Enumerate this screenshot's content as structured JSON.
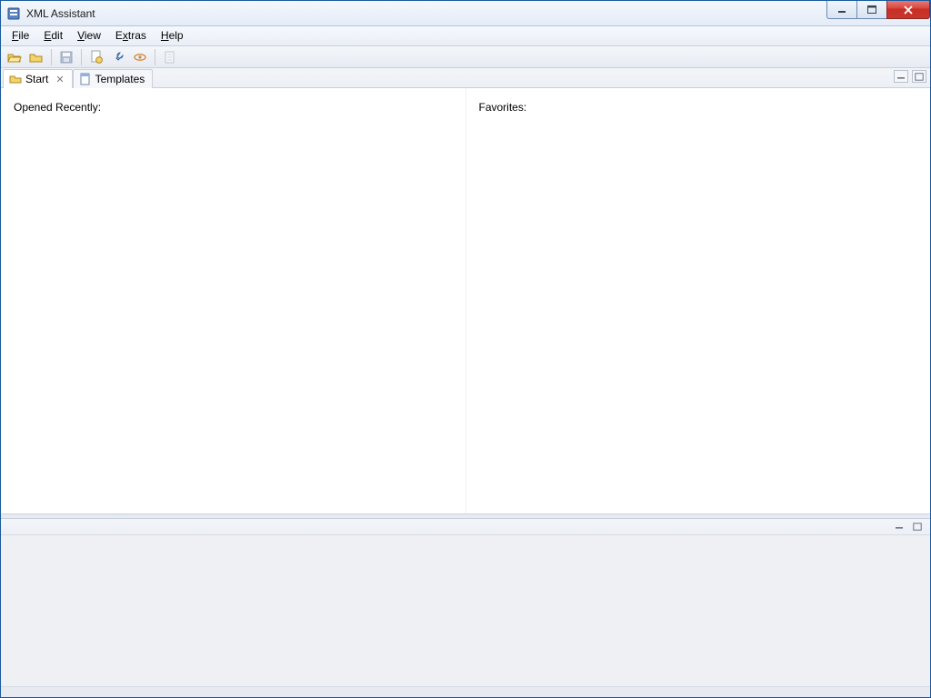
{
  "window": {
    "title": "XML Assistant"
  },
  "menu": {
    "file": "File",
    "edit": "Edit",
    "view": "View",
    "extras": "Extras",
    "help": "Help"
  },
  "toolbar": {
    "icons": {
      "open": "open-folder-icon",
      "open2": "folder-icon",
      "save": "save-icon",
      "pref": "document-gear-icon",
      "key": "wrench-icon",
      "eye": "eye-icon",
      "page": "page-icon"
    }
  },
  "tabs": {
    "start": "Start",
    "templates": "Templates"
  },
  "main": {
    "recent_label": "Opened Recently:",
    "favorites_label": "Favorites:"
  }
}
